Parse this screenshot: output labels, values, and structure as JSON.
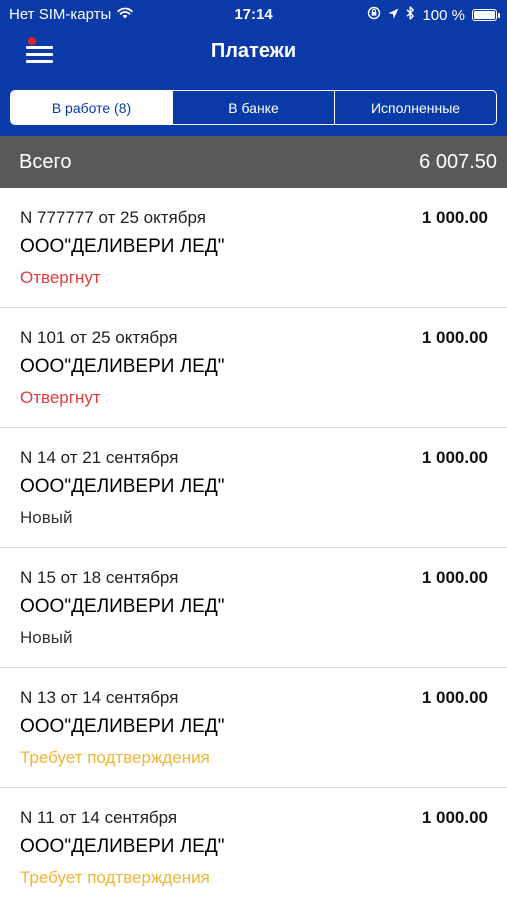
{
  "status_bar": {
    "carrier": "Нет SIM-карты",
    "time": "17:14",
    "battery": "100 %",
    "battery_level": 1.0
  },
  "nav": {
    "title": "Платежи"
  },
  "tabs": [
    {
      "label": "В работе (8)",
      "active": true
    },
    {
      "label": "В банке",
      "active": false
    },
    {
      "label": "Исполненные",
      "active": false
    }
  ],
  "total": {
    "label": "Всего",
    "value": "6 007.50"
  },
  "payments": [
    {
      "number": "N 777777 от 25 октября",
      "amount": "1 000.00",
      "name": "ООО\"ДЕЛИВЕРИ ЛЕД\"",
      "status": "Отвергнут",
      "status_kind": "rejected"
    },
    {
      "number": "N 101 от 25 октября",
      "amount": "1 000.00",
      "name": "ООО\"ДЕЛИВЕРИ ЛЕД\"",
      "status": "Отвергнут",
      "status_kind": "rejected"
    },
    {
      "number": "N 14 от 21 сентября",
      "amount": "1 000.00",
      "name": "ООО\"ДЕЛИВЕРИ ЛЕД\"",
      "status": "Новый",
      "status_kind": "new"
    },
    {
      "number": "N 15 от 18 сентября",
      "amount": "1 000.00",
      "name": "ООО\"ДЕЛИВЕРИ ЛЕД\"",
      "status": "Новый",
      "status_kind": "new"
    },
    {
      "number": "N 13 от 14 сентября",
      "amount": "1 000.00",
      "name": "ООО\"ДЕЛИВЕРИ ЛЕД\"",
      "status": "Требует подтверждения",
      "status_kind": "pending"
    },
    {
      "number": "N 11 от 14 сентября",
      "amount": "1 000.00",
      "name": "ООО\"ДЕЛИВЕРИ ЛЕД\"",
      "status": "Требует подтверждения",
      "status_kind": "pending"
    }
  ],
  "colors": {
    "header_bg": "#0a3aa8",
    "total_bg": "#595959",
    "status_rejected": "#e23b3b",
    "status_new": "#333333",
    "status_pending": "#f1b632"
  },
  "icons": [
    "wifi-icon",
    "orientation-lock-icon",
    "location-icon",
    "bluetooth-icon",
    "battery-icon",
    "menu-icon",
    "notification-dot"
  ]
}
